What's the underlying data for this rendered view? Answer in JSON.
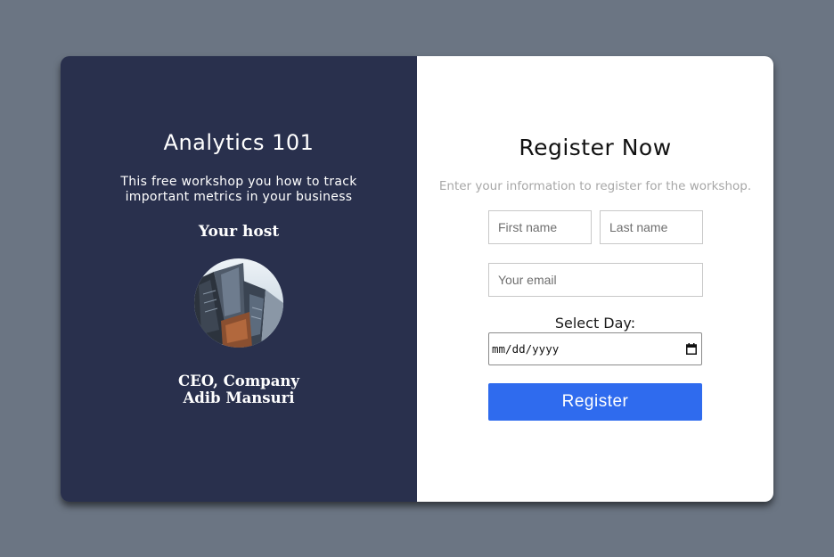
{
  "event": {
    "title": "Analytics 101",
    "description": "This free workshop you how to track important metrics in your business",
    "host_heading": "Your host",
    "host_role": "CEO, Company",
    "host_name": "Adib Mansuri"
  },
  "registration": {
    "title": "Register Now",
    "subtitle": "Enter your information to register for the workshop.",
    "first_name_placeholder": "First name",
    "last_name_placeholder": "Last name",
    "email_placeholder": "Your email",
    "day_label": "Select Day:",
    "date_placeholder": "mm/dd/yyyy",
    "register_label": "Register"
  },
  "icons": {
    "calendar": "calendar-icon",
    "avatar": "host-avatar"
  },
  "colors": {
    "background": "#6b7583",
    "left_panel": "#29304d",
    "right_panel": "#ffffff",
    "button": "#2f6bee",
    "subtitle": "#a7a7a7"
  }
}
